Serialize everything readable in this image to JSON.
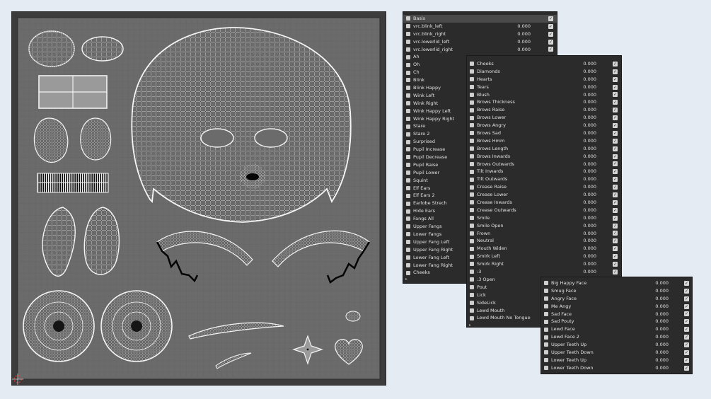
{
  "uv_editor": {
    "cursor_icon": "cursor-crosshair-icon"
  },
  "panel1": {
    "rows": [
      {
        "name": "Basis",
        "value": "",
        "checked": true,
        "selected": true
      },
      {
        "name": "vrc.blink_left",
        "value": "0.000",
        "checked": true
      },
      {
        "name": "vrc.blink_right",
        "value": "0.000",
        "checked": true
      },
      {
        "name": "vrc.lowerlid_left",
        "value": "0.000",
        "checked": true
      },
      {
        "name": "vrc.lowerlid_right",
        "value": "0.000",
        "checked": true
      },
      {
        "name": "Ah",
        "value": "",
        "checked": false
      },
      {
        "name": "Oh",
        "value": "",
        "checked": false
      },
      {
        "name": "Ch",
        "value": "",
        "checked": false
      },
      {
        "name": "Blink",
        "value": "",
        "checked": false
      },
      {
        "name": "Blink Happy",
        "value": "",
        "checked": false
      },
      {
        "name": "Wink Left",
        "value": "",
        "checked": false
      },
      {
        "name": "Wink Right",
        "value": "",
        "checked": false
      },
      {
        "name": "Wink Happy Left",
        "value": "",
        "checked": false
      },
      {
        "name": "Wink Happy Right",
        "value": "",
        "checked": false
      },
      {
        "name": "Stare",
        "value": "",
        "checked": false
      },
      {
        "name": "Stare 2",
        "value": "",
        "checked": false
      },
      {
        "name": "Surprised",
        "value": "",
        "checked": false
      },
      {
        "name": "Pupil Increase",
        "value": "",
        "checked": false
      },
      {
        "name": "Pupil Decrease",
        "value": "",
        "checked": false
      },
      {
        "name": "Pupil Raise",
        "value": "",
        "checked": false
      },
      {
        "name": "Pupil Lower",
        "value": "",
        "checked": false
      },
      {
        "name": "Squint",
        "value": "",
        "checked": false
      },
      {
        "name": "Elf Ears",
        "value": "",
        "checked": false
      },
      {
        "name": "Elf Ears 2",
        "value": "",
        "checked": false
      },
      {
        "name": "Earlobe Strech",
        "value": "",
        "checked": false
      },
      {
        "name": "Hide Ears",
        "value": "",
        "checked": false
      },
      {
        "name": "Fangs All",
        "value": "",
        "checked": false
      },
      {
        "name": "Upper Fangs",
        "value": "",
        "checked": false
      },
      {
        "name": "Lower Fangs",
        "value": "",
        "checked": false
      },
      {
        "name": "Upper Fang Left",
        "value": "",
        "checked": false
      },
      {
        "name": "Upper Fang Right",
        "value": "",
        "checked": false
      },
      {
        "name": "Lower Fang Left",
        "value": "",
        "checked": false
      },
      {
        "name": "Lower Fang Right",
        "value": "",
        "checked": false
      },
      {
        "name": "Cheeks",
        "value": "",
        "checked": false
      }
    ],
    "footer": "▸"
  },
  "panel2": {
    "rows": [
      {
        "name": "Cheeks",
        "value": "0.000",
        "checked": true
      },
      {
        "name": "Diamonds",
        "value": "0.000",
        "checked": true
      },
      {
        "name": "Hearts",
        "value": "0.000",
        "checked": true
      },
      {
        "name": "Tears",
        "value": "0.000",
        "checked": true
      },
      {
        "name": "Blush",
        "value": "0.000",
        "checked": true
      },
      {
        "name": "Brows Thickness",
        "value": "0.000",
        "checked": true
      },
      {
        "name": "Brows Raise",
        "value": "0.000",
        "checked": true
      },
      {
        "name": "Brows Lower",
        "value": "0.000",
        "checked": true
      },
      {
        "name": "Brows Angry",
        "value": "0.000",
        "checked": true
      },
      {
        "name": "Brows Sad",
        "value": "0.000",
        "checked": true
      },
      {
        "name": "Brows Hmm",
        "value": "0.000",
        "checked": true
      },
      {
        "name": "Brows Length",
        "value": "0.000",
        "checked": true
      },
      {
        "name": "Brows Inwards",
        "value": "0.000",
        "checked": true
      },
      {
        "name": "Brows Outwards",
        "value": "0.000",
        "checked": true
      },
      {
        "name": "Tilt Inwards",
        "value": "0.000",
        "checked": true
      },
      {
        "name": "Tilt Outwards",
        "value": "0.000",
        "checked": true
      },
      {
        "name": "Crease Raise",
        "value": "0.000",
        "checked": true
      },
      {
        "name": "Crease Lower",
        "value": "0.000",
        "checked": true
      },
      {
        "name": "Crease Inwards",
        "value": "0.000",
        "checked": true
      },
      {
        "name": "Crease Outwards",
        "value": "0.000",
        "checked": true
      },
      {
        "name": "Smile",
        "value": "0.000",
        "checked": true
      },
      {
        "name": "Smile Open",
        "value": "0.000",
        "checked": true
      },
      {
        "name": "Frown",
        "value": "0.000",
        "checked": true
      },
      {
        "name": "Neutral",
        "value": "0.000",
        "checked": true
      },
      {
        "name": "Mouth Widen",
        "value": "0.000",
        "checked": true
      },
      {
        "name": "Smirk Left",
        "value": "0.000",
        "checked": true
      },
      {
        "name": "Smirk Right",
        "value": "0.000",
        "checked": true
      },
      {
        "name": ":3",
        "value": "0.000",
        "checked": true
      },
      {
        "name": ":3 Open",
        "value": "",
        "checked": false
      },
      {
        "name": "Pout",
        "value": "",
        "checked": false
      },
      {
        "name": "Lick",
        "value": "",
        "checked": false
      },
      {
        "name": "SideLick",
        "value": "",
        "checked": false
      },
      {
        "name": "Lewd Mouth",
        "value": "",
        "checked": false
      },
      {
        "name": "Lewd Mouth No Tongue",
        "value": "",
        "checked": false
      }
    ],
    "footer": "▸"
  },
  "panel3": {
    "rows": [
      {
        "name": "Big Happy Face",
        "value": "0.000",
        "checked": true
      },
      {
        "name": "Smug Face",
        "value": "0.000",
        "checked": true
      },
      {
        "name": "Angry Face",
        "value": "0.000",
        "checked": true
      },
      {
        "name": "Me Angy",
        "value": "0.000",
        "checked": true
      },
      {
        "name": "Sad Face",
        "value": "0.000",
        "checked": true
      },
      {
        "name": "Sad Pouty",
        "value": "0.000",
        "checked": true
      },
      {
        "name": "Lewd Face",
        "value": "0.000",
        "checked": true
      },
      {
        "name": "Lewd Face 2",
        "value": "0.000",
        "checked": true
      },
      {
        "name": "Upper Teeth Up",
        "value": "0.000",
        "checked": true
      },
      {
        "name": "Upper Teeth Down",
        "value": "0.000",
        "checked": true
      },
      {
        "name": "Lower Teeth Up",
        "value": "0.000",
        "checked": true
      },
      {
        "name": "Lower Teeth Down",
        "value": "0.000",
        "checked": true
      }
    ]
  },
  "checkmark_glyph": "✓"
}
